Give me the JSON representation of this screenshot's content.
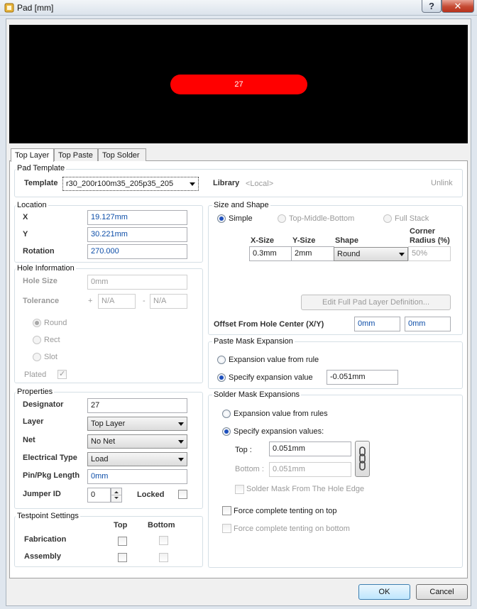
{
  "window": {
    "title": "Pad [mm]",
    "help_glyph": "?",
    "close_glyph": "✕"
  },
  "preview": {
    "pad_label": "27",
    "pad_color": "#ff0000",
    "background": "#000000"
  },
  "tabs": [
    {
      "label": "Top Layer"
    },
    {
      "label": "Top Paste"
    },
    {
      "label": "Top Solder"
    }
  ],
  "pad_template": {
    "group_title": "Pad Template",
    "template_label": "Template",
    "template_value": "r30_200r100m35_205p35_205",
    "library_label": "Library",
    "library_value": "<Local>",
    "unlink_label": "Unlink"
  },
  "location": {
    "group_title": "Location",
    "x_label": "X",
    "x_value": "19.127mm",
    "y_label": "Y",
    "y_value": "30.221mm",
    "rotation_label": "Rotation",
    "rotation_value": "270.000"
  },
  "hole": {
    "group_title": "Hole Information",
    "size_label": "Hole Size",
    "size_value": "0mm",
    "tolerance_label": "Tolerance",
    "plus": "+",
    "minus": "-",
    "tol_plus": "N/A",
    "tol_minus": "N/A",
    "round": "Round",
    "rect": "Rect",
    "slot": "Slot",
    "plated": "Plated"
  },
  "properties": {
    "group_title": "Properties",
    "designator_label": "Designator",
    "designator_value": "27",
    "layer_label": "Layer",
    "layer_value": "Top Layer",
    "net_label": "Net",
    "net_value": "No Net",
    "electrical_label": "Electrical Type",
    "electrical_value": "Load",
    "pinpkg_label": "Pin/Pkg Length",
    "pinpkg_value": "0mm",
    "jumper_label": "Jumper ID",
    "jumper_value": "0",
    "locked_label": "Locked"
  },
  "testpoint": {
    "group_title": "Testpoint Settings",
    "top": "Top",
    "bottom": "Bottom",
    "fabrication": "Fabrication",
    "assembly": "Assembly"
  },
  "size_shape": {
    "group_title": "Size and Shape",
    "simple": "Simple",
    "tmb": "Top-Middle-Bottom",
    "full_stack": "Full Stack",
    "xsize_label": "X-Size",
    "ysize_label": "Y-Size",
    "shape_label": "Shape",
    "corner_label_1": "Corner",
    "corner_label_2": "Radius (%)",
    "xsize_value": "0.3mm",
    "ysize_value": "2mm",
    "shape_value": "Round",
    "corner_value": "50%",
    "edit_button": "Edit Full Pad Layer Definition...",
    "offset_label": "Offset From Hole Center (X/Y)",
    "offset_x": "0mm",
    "offset_y": "0mm"
  },
  "paste": {
    "group_title": "Paste Mask Expansion",
    "from_rule": "Expansion value from rule",
    "specify": "Specify expansion value",
    "value": "-0.051mm"
  },
  "solder": {
    "group_title": "Solder Mask Expansions",
    "from_rules": "Expansion value from rules",
    "specify": "Specify expansion values:",
    "top_label": "Top :",
    "top_value": "0.051mm",
    "bottom_label": "Bottom :",
    "bottom_value": "0.051mm",
    "from_hole": "Solder Mask From The Hole Edge",
    "tent_top": "Force complete tenting on top",
    "tent_bottom": "Force complete tenting on bottom"
  },
  "footer": {
    "ok": "OK",
    "cancel": "Cancel"
  }
}
